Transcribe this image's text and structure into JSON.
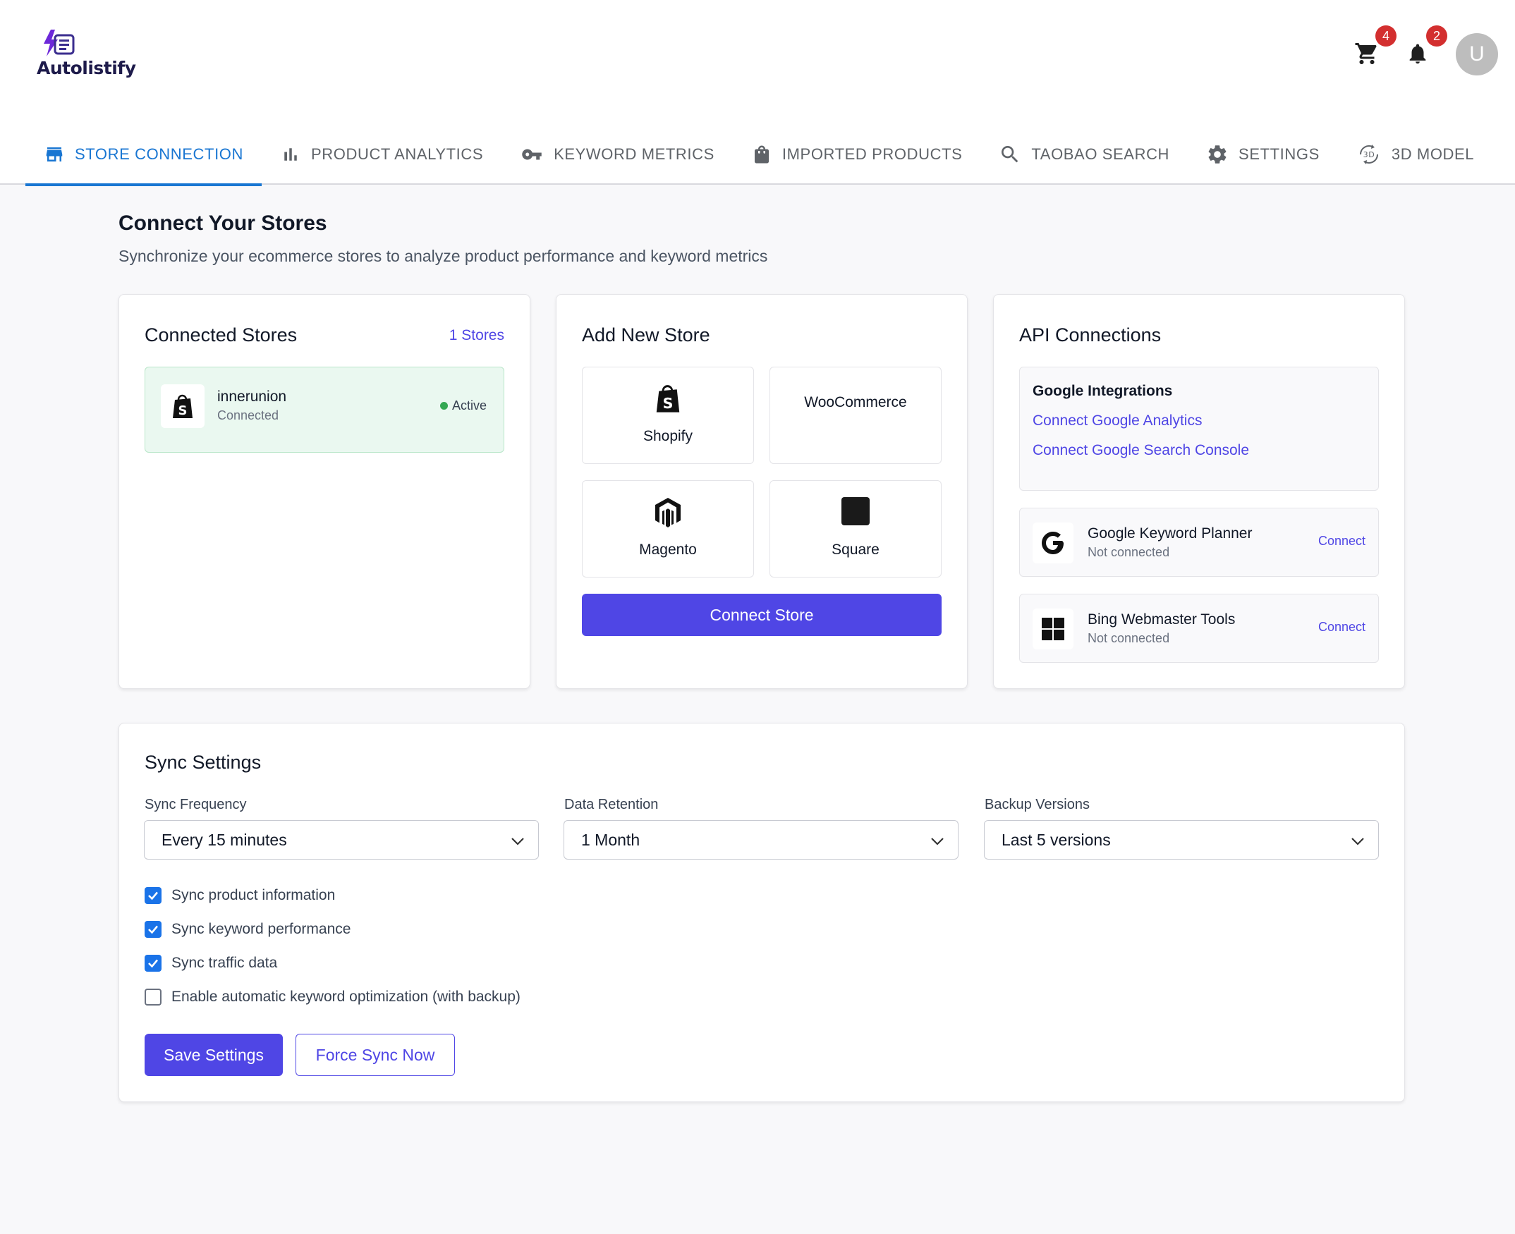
{
  "app": {
    "name": "Autolistify"
  },
  "header": {
    "cart_badge": "4",
    "notifications_badge": "2",
    "avatar_initial": "U"
  },
  "tabs": [
    {
      "label": "STORE CONNECTION",
      "icon": "store-icon",
      "active": true
    },
    {
      "label": "PRODUCT ANALYTICS",
      "icon": "bar-chart-icon"
    },
    {
      "label": "KEYWORD METRICS",
      "icon": "key-icon"
    },
    {
      "label": "IMPORTED PRODUCTS",
      "icon": "shopping-bag-icon"
    },
    {
      "label": "TAOBAO SEARCH",
      "icon": "search-icon"
    },
    {
      "label": "SETTINGS",
      "icon": "gear-icon"
    },
    {
      "label": "3D MODEL",
      "icon": "3d-rotation-icon"
    }
  ],
  "page": {
    "title": "Connect Your Stores",
    "subtitle": "Synchronize your ecommerce stores to analyze product performance and keyword metrics"
  },
  "connected_stores": {
    "title": "Connected Stores",
    "count_label": "1 Stores",
    "stores": [
      {
        "name": "innerunion",
        "status": "Connected",
        "state": "Active",
        "platform_icon": "shopify-icon"
      }
    ]
  },
  "add_store": {
    "title": "Add New Store",
    "platforms": [
      {
        "label": "Shopify",
        "icon": "shopify-icon"
      },
      {
        "label": "WooCommerce",
        "icon": ""
      },
      {
        "label": "Magento",
        "icon": "magento-icon"
      },
      {
        "label": "Square",
        "icon": "square-icon"
      }
    ],
    "connect_button": "Connect Store"
  },
  "api_connections": {
    "title": "API Connections",
    "google": {
      "title": "Google Integrations",
      "links": [
        "Connect Google Analytics",
        "Connect Google Search Console"
      ]
    },
    "services": [
      {
        "name": "Google Keyword Planner",
        "status": "Not connected",
        "action": "Connect",
        "icon": "google-icon"
      },
      {
        "name": "Bing Webmaster Tools",
        "status": "Not connected",
        "action": "Connect",
        "icon": "windows-icon"
      }
    ]
  },
  "sync_settings": {
    "title": "Sync Settings",
    "fields": [
      {
        "label": "Sync Frequency",
        "value": "Every 15 minutes"
      },
      {
        "label": "Data Retention",
        "value": "1 Month"
      },
      {
        "label": "Backup Versions",
        "value": "Last 5 versions"
      }
    ],
    "options": [
      {
        "label": "Sync product information",
        "checked": true
      },
      {
        "label": "Sync keyword performance",
        "checked": true
      },
      {
        "label": "Sync traffic data",
        "checked": true
      },
      {
        "label": "Enable automatic keyword optimization (with backup)",
        "checked": false
      }
    ],
    "save_button": "Save Settings",
    "force_sync_button": "Force Sync Now"
  },
  "colors": {
    "primary": "#4f46e5",
    "tab_active": "#1976d2",
    "badge": "#d32f2f",
    "active_dot": "#34a853",
    "store_active_bg": "#eaf8f0"
  }
}
